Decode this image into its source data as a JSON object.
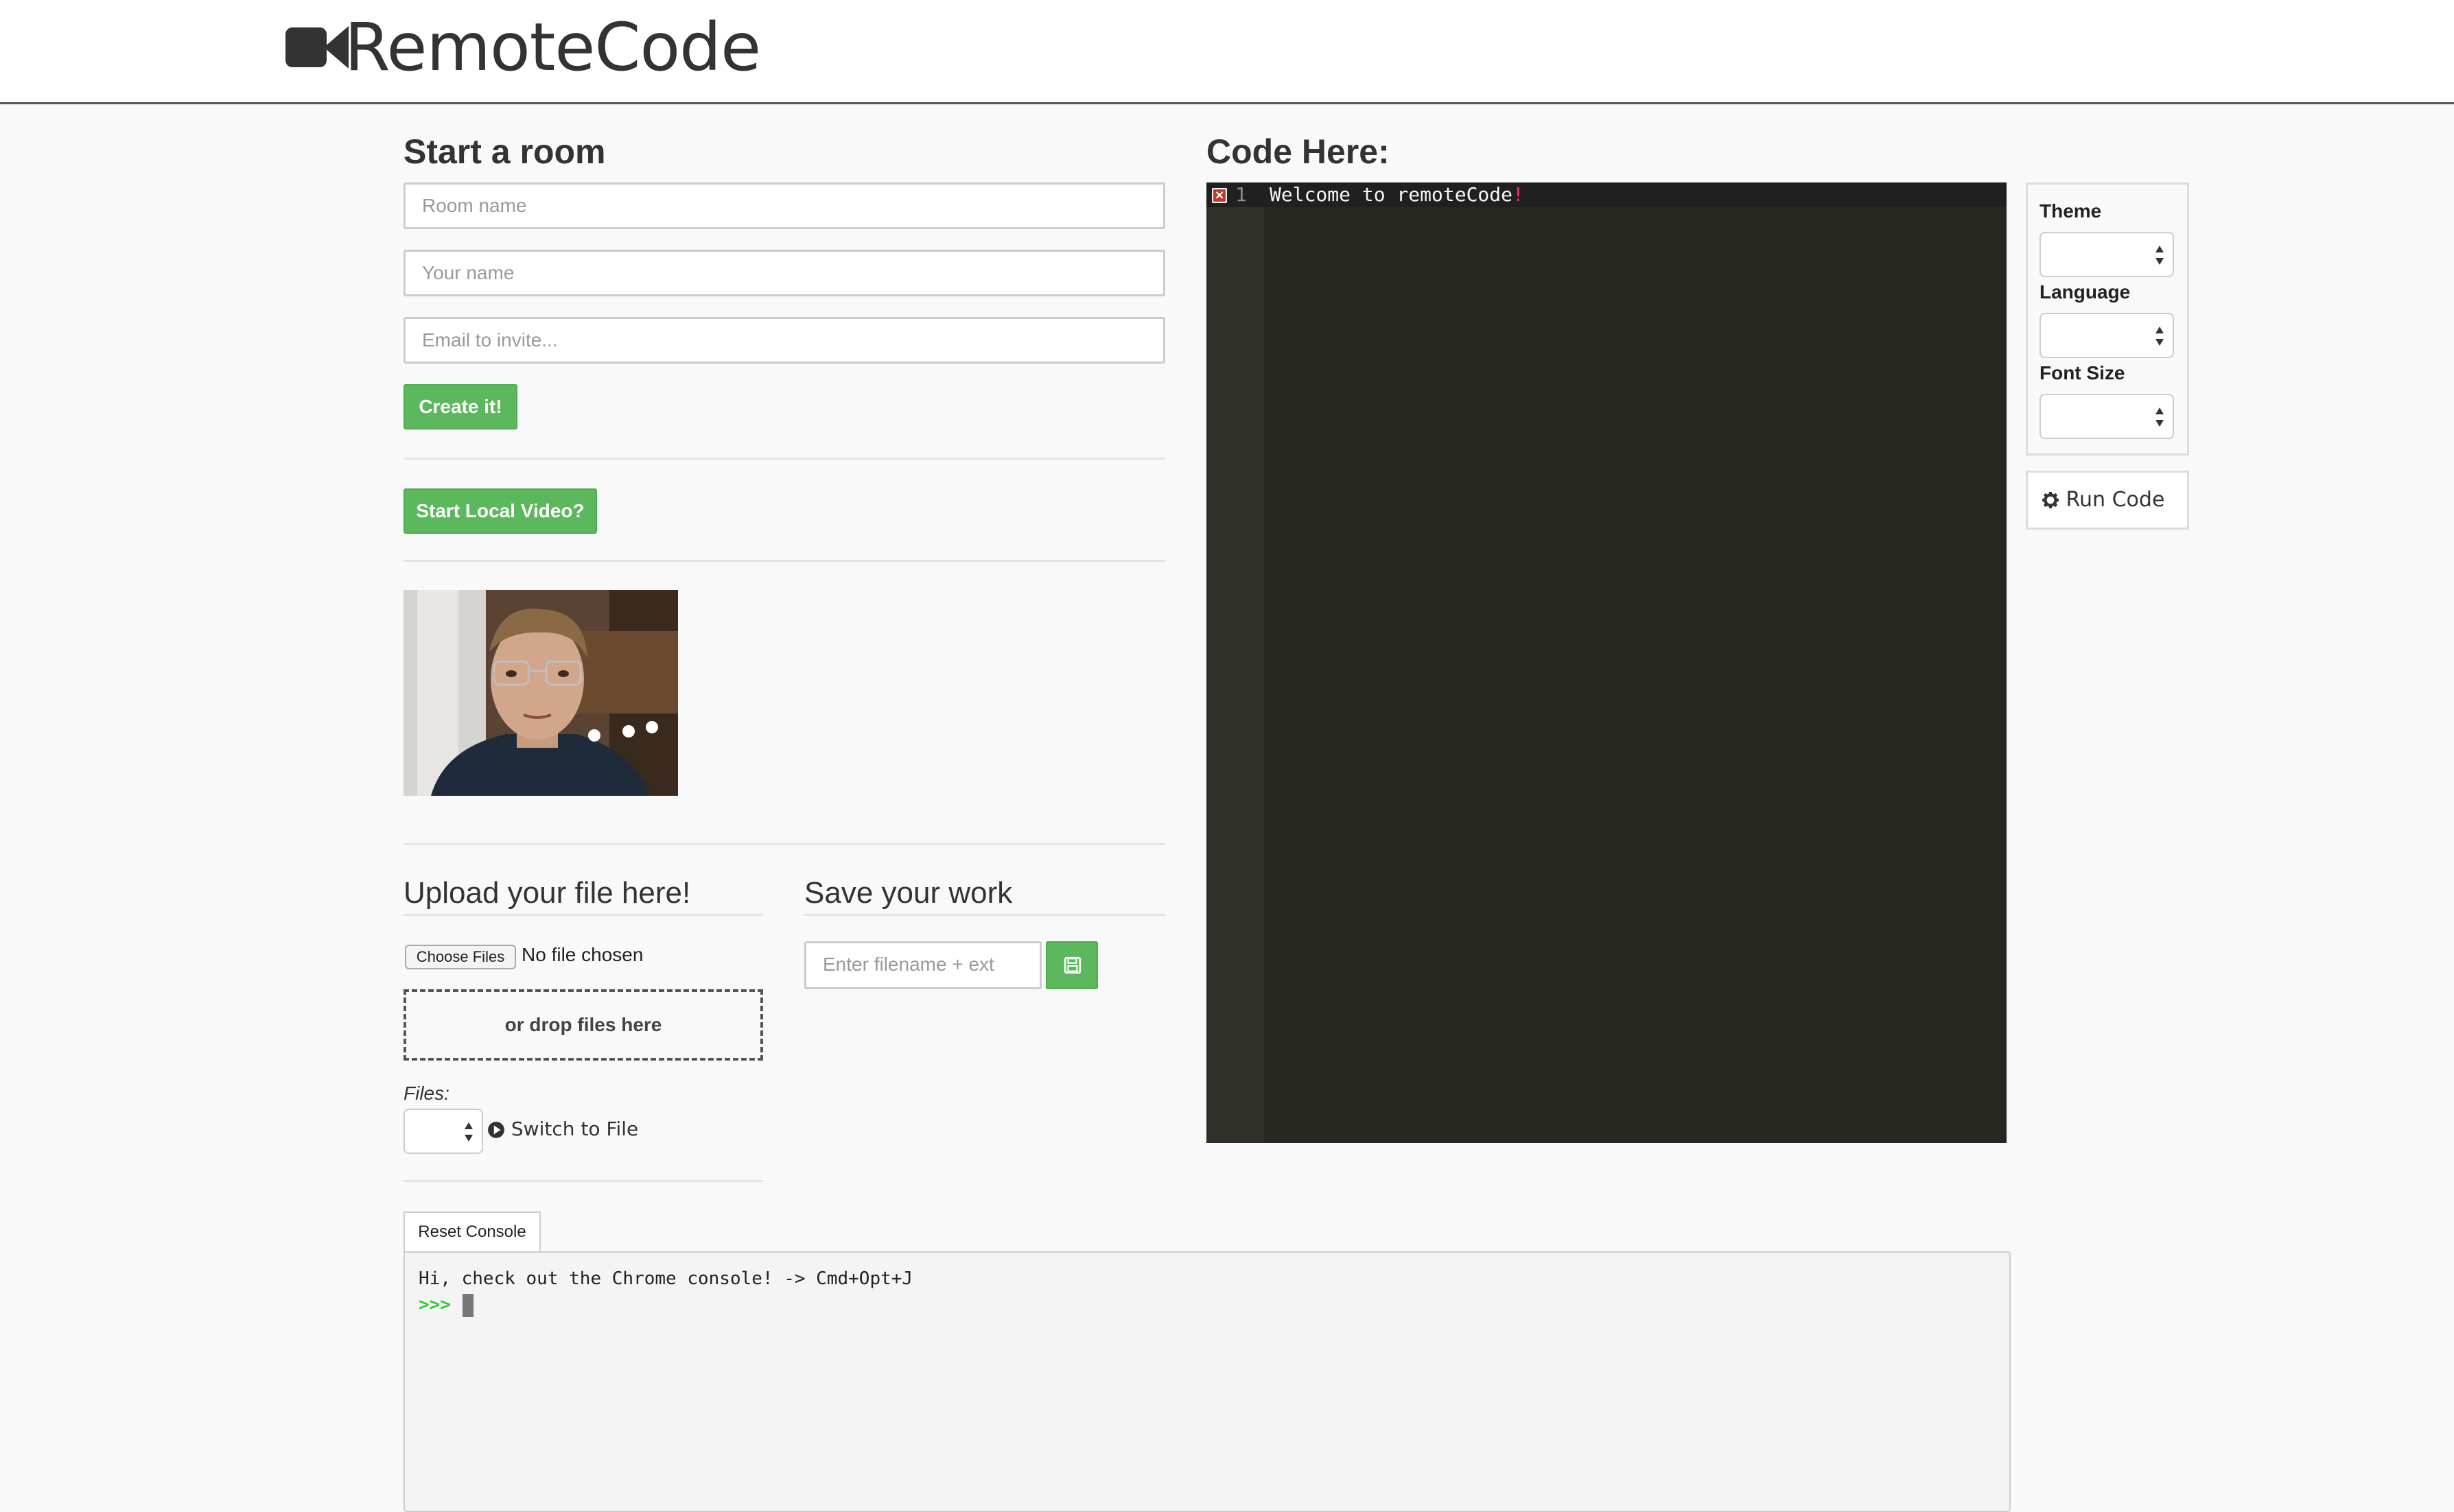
{
  "app": {
    "title": "RemoteCode",
    "logo_icon": "video-camera-icon"
  },
  "start_room": {
    "title": "Start a room",
    "room_name_placeholder": "Room name",
    "your_name_placeholder": "Your name",
    "email_placeholder": "Email to invite...",
    "create_label": "Create it!",
    "video_label": "Start Local Video?"
  },
  "upload": {
    "title": "Upload your file here!",
    "choose_files_label": "Choose Files",
    "no_file_text": "No file chosen",
    "dropzone_text": "or drop files here",
    "files_label": "Files:",
    "switch_label": "Switch to File",
    "switch_icon": "play-circle-icon"
  },
  "save": {
    "title": "Save your work",
    "filename_placeholder": "Enter filename + ext",
    "save_icon": "floppy-disk-icon"
  },
  "editor": {
    "title": "Code Here:",
    "line_number": "1",
    "code_text": "Welcome to remoteCode",
    "code_bang": "!",
    "error_icon": "error-marker-icon"
  },
  "settings": {
    "theme_label": "Theme",
    "language_label": "Language",
    "font_size_label": "Font Size",
    "run_label": "Run Code",
    "run_icon": "gear-icon"
  },
  "console": {
    "reset_label": "Reset Console",
    "message": "Hi, check out the Chrome console! -> Cmd+Opt+J",
    "prompt": ">>>"
  },
  "colors": {
    "accent_green": "#5cb85c",
    "editor_bg": "#272822",
    "prompt_green": "#2ecc2e"
  }
}
